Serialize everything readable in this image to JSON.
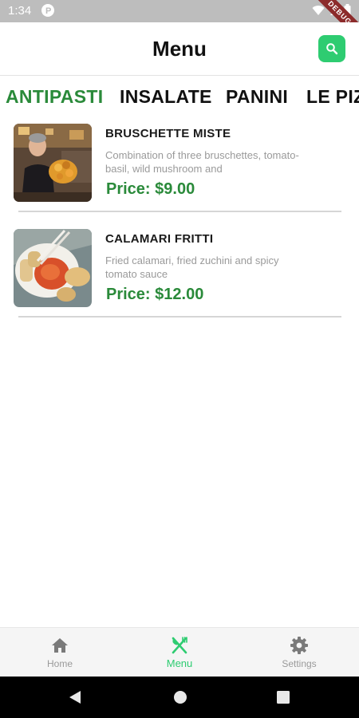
{
  "status_bar": {
    "time": "1:34",
    "debug_label": "DEBUG"
  },
  "header": {
    "title": "Menu"
  },
  "categories": [
    {
      "label": "ANTIPASTI",
      "active": true
    },
    {
      "label": "INSALATE",
      "active": false
    },
    {
      "label": "PANINI",
      "active": false
    },
    {
      "label": "LE PIZ",
      "active": false
    }
  ],
  "items": [
    {
      "name": "BRUSCHETTE MISTE",
      "description": "Combination of three bruschettes, tomato-basil, wild mushroom and",
      "price": "Price: $9.00"
    },
    {
      "name": "CALAMARI FRITTI",
      "description": "Fried calamari, fried zuchini and spicy tomato sauce",
      "price": "Price: $12.00"
    }
  ],
  "bottom_nav": [
    {
      "label": "Home",
      "icon": "home-icon",
      "active": false
    },
    {
      "label": "Menu",
      "icon": "fork-knife-icon",
      "active": true
    },
    {
      "label": "Settings",
      "icon": "gear-icon",
      "active": false
    }
  ],
  "colors": {
    "accent": "#2ecc71",
    "price_green": "#2a8a3a",
    "status_bar": "#bdbdbd"
  }
}
